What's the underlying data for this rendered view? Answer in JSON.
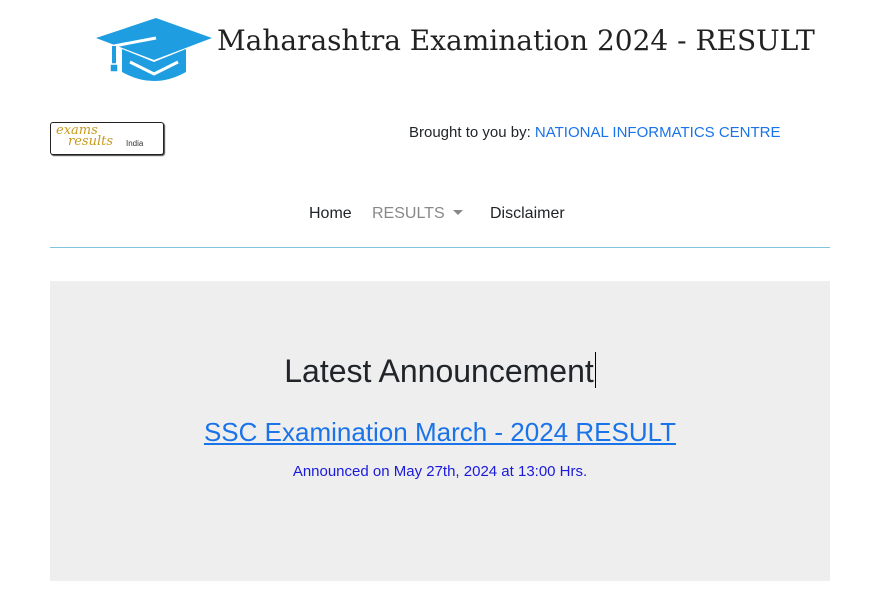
{
  "header": {
    "title": "Maharashtra Examination 2024 - RESULT",
    "logo_icon": "graduation-cap-icon",
    "accent_color": "#1e9ee0"
  },
  "partner": {
    "logo_text_top": "exams",
    "logo_text_bottom": "results",
    "logo_text_small": "India",
    "brought_by_label": "Brought to you by: ",
    "brought_by_org": "NATIONAL INFORMATICS CENTRE",
    "link_color": "#1a73e8"
  },
  "nav": {
    "items": [
      {
        "label": "Home"
      },
      {
        "label": "RESULTS"
      },
      {
        "label": "Disclaimer"
      }
    ]
  },
  "announcement": {
    "heading": "Latest Announcement",
    "link_text": "SSC Examination March - 2024 RESULT",
    "date_text": "Announced on May 27th, 2024 at 13:00 Hrs."
  }
}
